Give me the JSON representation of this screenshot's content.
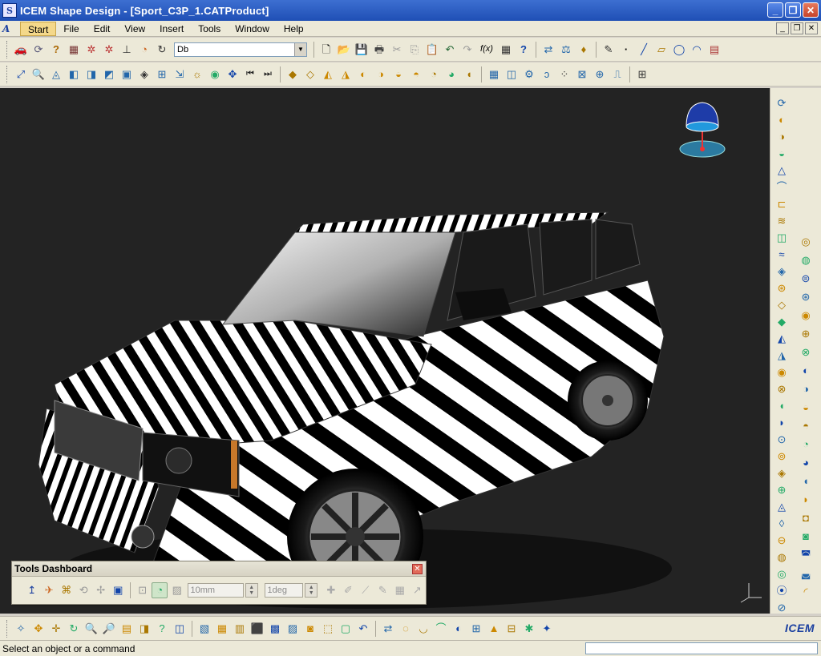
{
  "window": {
    "title": "ICEM Shape Design - [Sport_C3P_1.CATProduct]",
    "min_glyph": "_",
    "max_glyph": "❐",
    "close_glyph": "✕",
    "logo_glyph": "S"
  },
  "menubar": {
    "logo_glyph": "A",
    "items": [
      "Start",
      "File",
      "Edit",
      "View",
      "Insert",
      "Tools",
      "Window",
      "Help"
    ],
    "mdi_min": "_",
    "mdi_restore": "❐",
    "mdi_close": "✕"
  },
  "toolbar1": {
    "combo_value": "Db",
    "combo_arrow": "▼",
    "icons_left": [
      "car-icon",
      "refresh-icon",
      "help-icon",
      "stack-icon",
      "network-icon",
      "network2-icon",
      "axis-icon",
      "pie-icon",
      "sync-icon"
    ],
    "icons_mid": [
      "new-icon",
      "open-icon",
      "save-icon",
      "print-icon",
      "cut-icon",
      "copy-icon",
      "paste-icon",
      "undo-icon",
      "redo-icon",
      "formula-icon",
      "grid-icon",
      "whatsthis-icon"
    ],
    "icons_right": [
      "snap-icon",
      "scale-icon",
      "bottle-icon",
      "sketch-icon",
      "point-icon",
      "line-icon",
      "plane-icon",
      "circle-icon",
      "arc-icon",
      "copy-paste-icon"
    ],
    "glyphs_left": [
      "🚗",
      "⟳",
      "?",
      "▦",
      "✲",
      "✲",
      "⊥",
      "◔",
      "↻"
    ],
    "glyphs_mid": [
      "🗋",
      "📂",
      "💾",
      "🖶",
      "✂",
      "⎘",
      "📋",
      "↶",
      "↷",
      "f(x)",
      "▦",
      "?"
    ],
    "glyphs_right": [
      "⇄",
      "⚖",
      "♦",
      "✎",
      "·",
      "╱",
      "▱",
      "◯",
      "◠",
      "▤"
    ]
  },
  "toolbar2": {
    "icons": [
      "fit-all-icon",
      "zoom-area-icon",
      "shape-icon",
      "iso-view-icon",
      "front-view-icon",
      "side-view-icon",
      "cube-view-icon",
      "render-icon",
      "quad-view-icon",
      "hide-icon",
      "lights-icon",
      "palette-icon",
      "pan-icon",
      "prev-icon",
      "next-icon"
    ],
    "glyphs": [
      "⤢",
      "🔍",
      "◬",
      "◧",
      "◨",
      "◩",
      "▣",
      "◈",
      "⊞",
      "⇲",
      "☼",
      "◉",
      "✥",
      "⏮",
      "⏭"
    ],
    "icons_b": [
      "surf1-icon",
      "surf2-icon",
      "surf3-icon",
      "surf4-icon",
      "surf5-icon",
      "surf6-icon",
      "surf7-icon",
      "surf8-icon",
      "surf9-icon",
      "surf10-icon",
      "surf11-icon"
    ],
    "glyphs_b": [
      "◆",
      "◇",
      "◭",
      "◮",
      "◐",
      "◑",
      "◒",
      "◓",
      "◔",
      "◕",
      "◖"
    ],
    "icons_c": [
      "table-icon",
      "split-icon",
      "analysis-icon",
      "curvature-icon",
      "dots-icon",
      "fitgrid-icon",
      "diagnostic-icon",
      "reflect-icon",
      "extra-icon"
    ],
    "glyphs_c": [
      "▦",
      "◫",
      "⚙",
      "ↄ",
      "⁘",
      "⊠",
      "⊕",
      "⎍",
      "⊞"
    ]
  },
  "right_toolbar": {
    "col1": [
      "⟳",
      "◐",
      "◑",
      "◒",
      "△",
      "⌒",
      "⊏",
      "≋",
      "◫",
      "≈",
      "◈",
      "⊛",
      "◇",
      "◆",
      "◭",
      "◮",
      "◉",
      "⊗",
      "◖",
      "◗",
      "⊙",
      "⊚",
      "◈",
      "⊕",
      "◬",
      "◊",
      "⊖",
      "◍",
      "◎",
      "⦿",
      "⊘"
    ],
    "col2": [
      "◎",
      "◍",
      "⊜",
      "⊛",
      "◉",
      "⊕",
      "⊗",
      "◐",
      "◑",
      "◒",
      "◓",
      "◔",
      "◕",
      "◖",
      "◗",
      "◘",
      "◙",
      "◚",
      "◛",
      "◜"
    ]
  },
  "bottom_toolbar": {
    "glyphs": [
      "✧",
      "✥",
      "✛",
      "↻",
      "🔍",
      "🔎",
      "▤",
      "◨",
      "?",
      "◫",
      "▧",
      "▦",
      "▥",
      "⬛",
      "▩",
      "▨",
      "◙",
      "⬚",
      "▢",
      "↶",
      "⇄",
      "◌",
      "◡",
      "⌒",
      "◐",
      "⊞",
      "▲",
      "⊟",
      "✱",
      "✦"
    ],
    "logo": "ICEM"
  },
  "viewport": {
    "background": "#232323"
  },
  "tools_dashboard": {
    "title": "Tools Dashboard",
    "close_glyph": "✕",
    "distance_value": "10mm",
    "angle_value": "1deg",
    "spin_up": "▲",
    "spin_down": "▼",
    "icons": [
      "↥",
      "✈",
      "⌘",
      "⟲",
      "✢",
      "▣"
    ],
    "icons_b": [
      "⊡",
      "◔",
      "▨"
    ],
    "icons_c": [
      "✚",
      "✐",
      "⟋",
      "✎",
      "▦",
      "↗"
    ]
  },
  "status": {
    "text": "Select an object or a command",
    "command_value": ""
  }
}
